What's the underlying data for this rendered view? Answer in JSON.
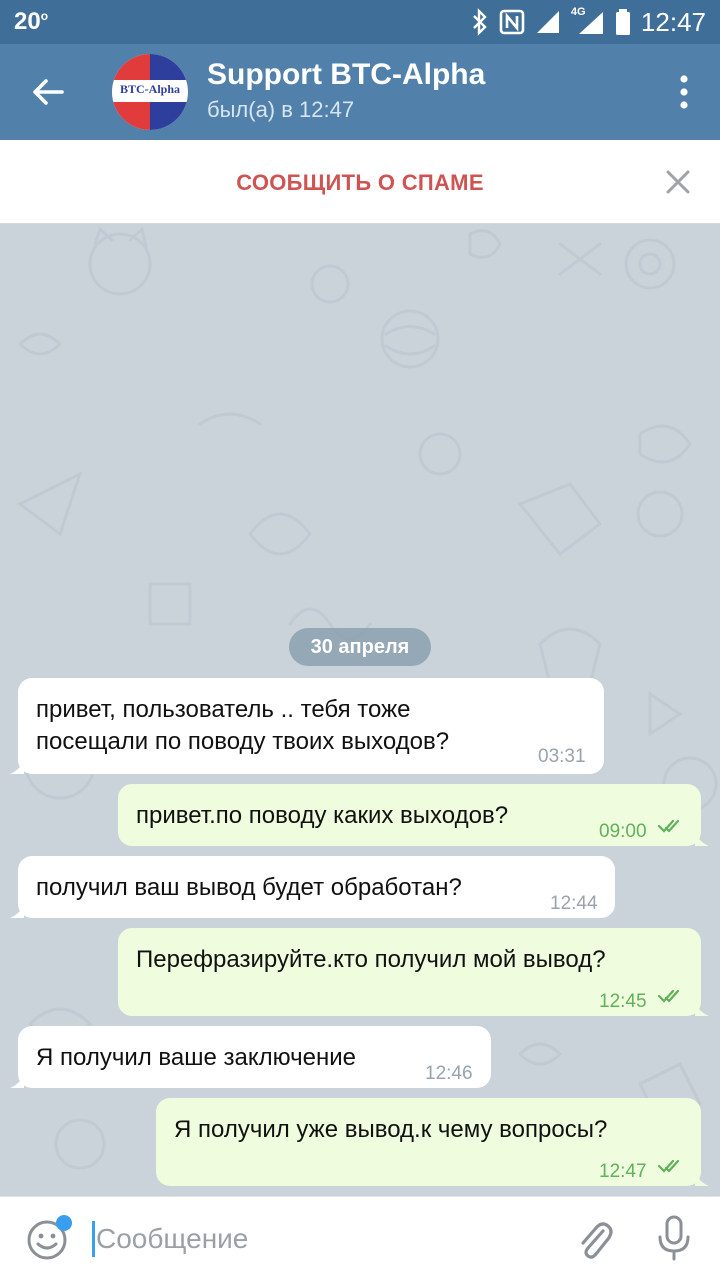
{
  "status_bar": {
    "left_value": "20",
    "left_superscript": "o",
    "network": "4G",
    "time": "12:47"
  },
  "header": {
    "avatar_text": "BTC-Alpha",
    "title": "Support BTC-Alpha",
    "subtitle": "был(а) в 12:47"
  },
  "spam_bar": {
    "label": "СООБЩИТЬ О СПАМЕ"
  },
  "chat": {
    "date_separator": "30 апреля",
    "messages": [
      {
        "direction": "in",
        "lines": [
          "привет, пользователь .. тебя тоже",
          "посещали по поводу твоих выходов?"
        ],
        "time": "03:31"
      },
      {
        "direction": "out",
        "lines": [
          "привет.по поводу каких выходов?"
        ],
        "time": "09:00",
        "read": true
      },
      {
        "direction": "in",
        "lines": [
          "получил ваш вывод будет обработан?"
        ],
        "time": "12:44"
      },
      {
        "direction": "out",
        "lines": [
          "Перефразируйте.кто получил мой вывод?"
        ],
        "time": "12:45",
        "read": true
      },
      {
        "direction": "in",
        "lines": [
          "Я получил ваше заключение"
        ],
        "time": "12:46"
      },
      {
        "direction": "out",
        "lines": [
          "Я получил уже вывод.к чему вопросы?"
        ],
        "time": "12:47",
        "read": true
      }
    ]
  },
  "input_bar": {
    "placeholder": "Сообщение"
  },
  "colors": {
    "header": "#5180ab",
    "status_bar": "#3f6f98",
    "spam_text": "#cf5353",
    "out_bubble": "#effdde",
    "out_time": "#5fb15a",
    "accent": "#3a9ef0"
  }
}
